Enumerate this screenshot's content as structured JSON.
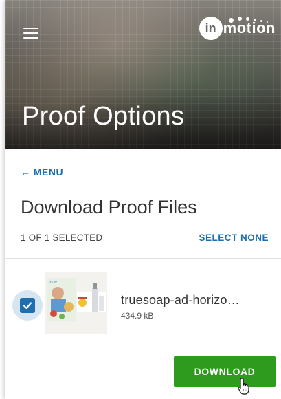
{
  "header": {
    "title": "Proof Options",
    "logo": {
      "circle_letter": "in",
      "text": "motion"
    },
    "menu_icon": "hamburger-menu-icon"
  },
  "nav": {
    "back_arrow": "←",
    "back_label": "MENU"
  },
  "main": {
    "title": "Download Proof Files",
    "selected_count": "1 OF 1 SELECTED",
    "select_none_label": "SELECT NONE",
    "files": [
      {
        "name": "truesoap-ad-horizo…",
        "size": "434.9 kB",
        "checked": true
      }
    ]
  },
  "actions": {
    "download_label": "DOWNLOAD"
  },
  "colors": {
    "accent": "#1f6fae",
    "download": "#2e9a1e"
  }
}
